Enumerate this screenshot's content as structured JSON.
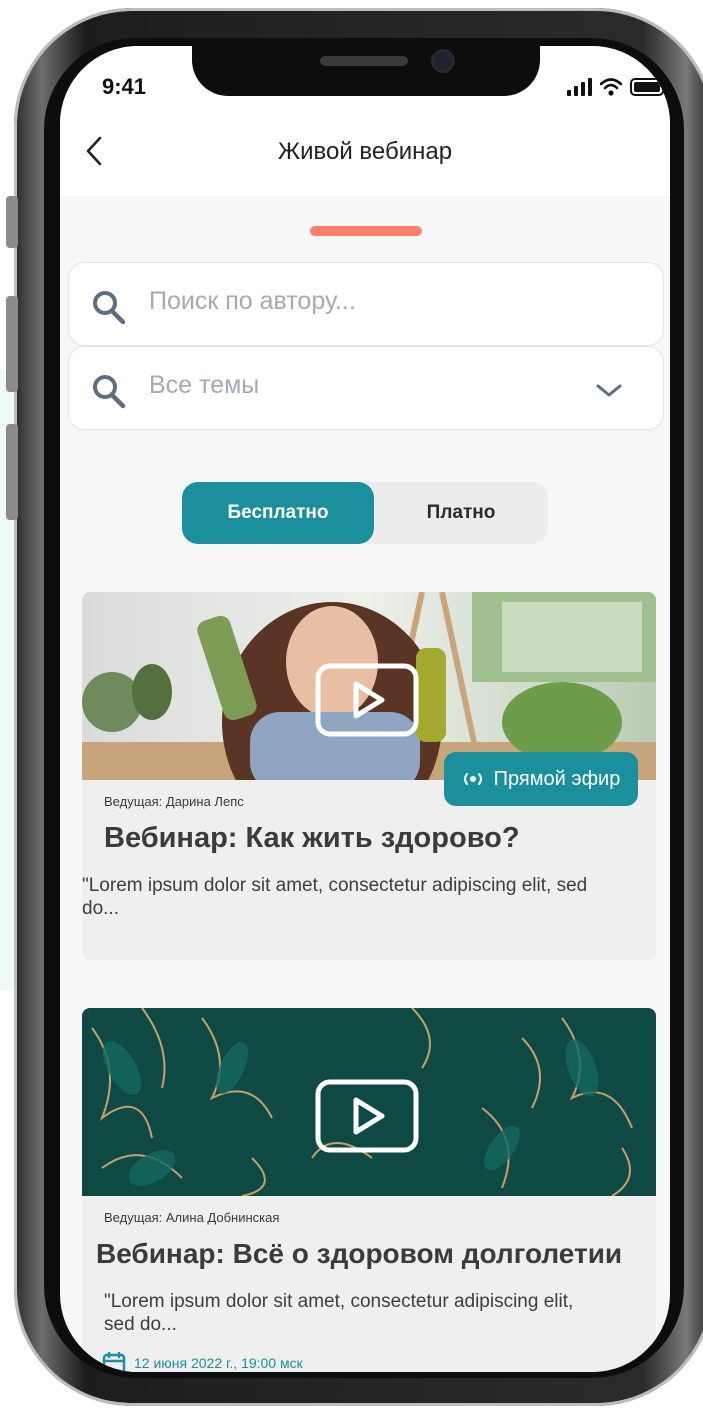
{
  "status_bar": {
    "time": "9:41"
  },
  "header": {
    "title": "Живой вебинар"
  },
  "filters": {
    "author_search": {
      "placeholder": "Поиск по автору..."
    },
    "topic_select": {
      "value": "Все темы"
    }
  },
  "segment": {
    "active": "Бесплатно",
    "inactive": "Платно"
  },
  "webinars": [
    {
      "host": "Ведущая: Дарина Лепс",
      "title": "Вебинар: Как жить здорово?",
      "description": "\"Lorem ipsum dolor sit amet, consectetur adipiscing elit, sed do...",
      "badge": "Прямой эфир"
    },
    {
      "host": "Ведущая: Алина Добнинская",
      "title": "Вебинар: Всё о здоровом долголетии",
      "description": "\"Lorem ipsum dolor sit amet, consectetur adipiscing elit, sed do...",
      "date": "12 июня 2022 г., 19:00 мск"
    }
  ],
  "colors": {
    "accent": "#1b8f9b",
    "handle": "#ff7f6b",
    "card_bg": "#efefef"
  },
  "icons": [
    "back-chevron-icon",
    "search-icon",
    "chevron-down-icon",
    "play-icon",
    "live-broadcast-icon",
    "calendar-icon",
    "signal-icon",
    "wifi-icon",
    "battery-icon"
  ]
}
